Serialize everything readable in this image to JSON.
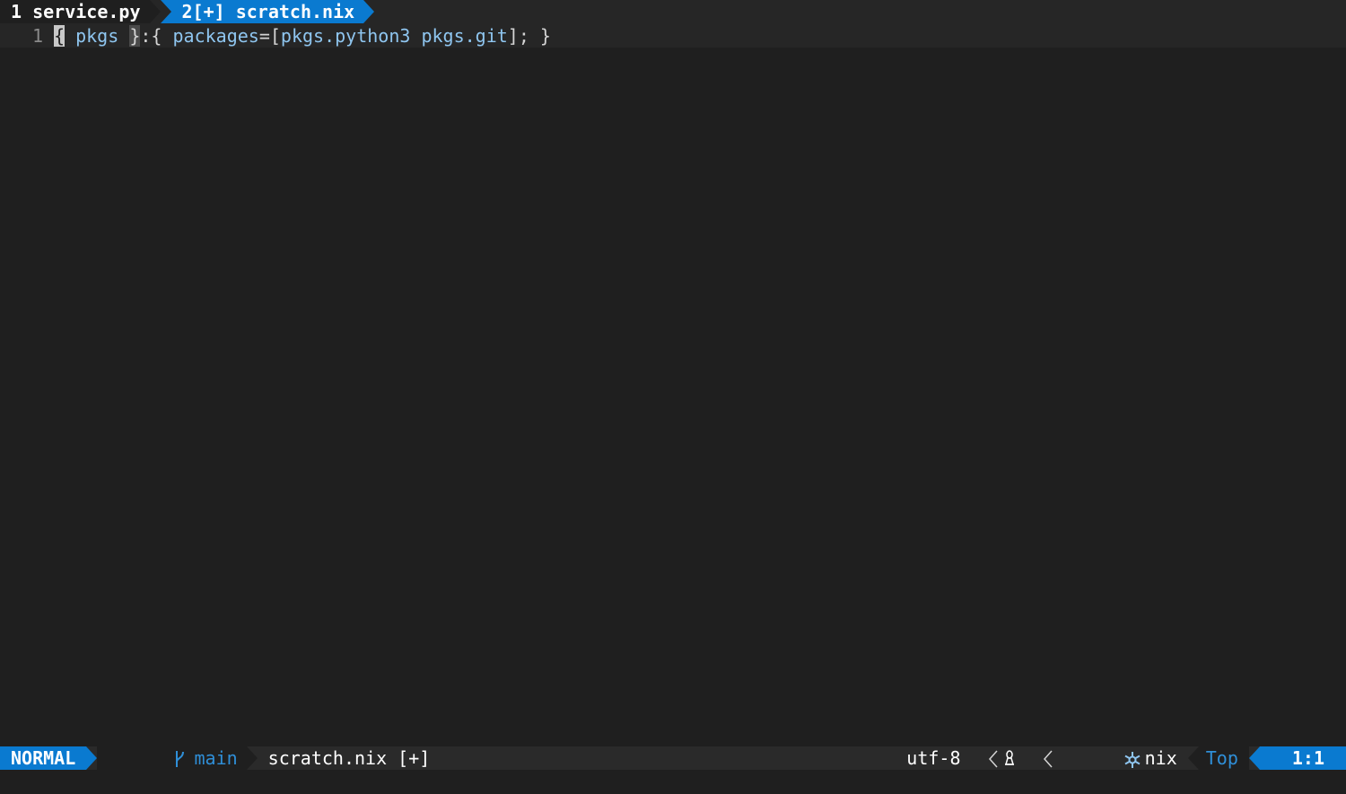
{
  "tabline": {
    "tabs": [
      {
        "label": "1 service.py",
        "active": false
      },
      {
        "label": "2[+] scratch.nix",
        "active": true
      }
    ]
  },
  "editor": {
    "lines": [
      {
        "number": "1"
      }
    ],
    "code": {
      "cursor_char": "{",
      "t1": " ",
      "pkgs_arg": "pkgs",
      "t2": " ",
      "match_char": "}",
      "t3": ":{ ",
      "packages_kw": "packages",
      "t4": "=[",
      "item1": "pkgs.python3",
      "t5": " ",
      "item2": "pkgs.git",
      "t6": "]; }"
    }
  },
  "statusline": {
    "mode": "NORMAL",
    "branch_icon": "git-branch-icon",
    "branch": "main",
    "filename": "scratch.nix [+]",
    "encoding": "utf-8",
    "os_icon": "linux-icon",
    "filetype_icon": "nix-snowflake-icon",
    "filetype": "nix",
    "scroll": "Top",
    "position": "1:1"
  },
  "colors": {
    "accent": "#0a7ad0",
    "background": "#1f1f1f",
    "identifier": "#8fc6f0"
  }
}
